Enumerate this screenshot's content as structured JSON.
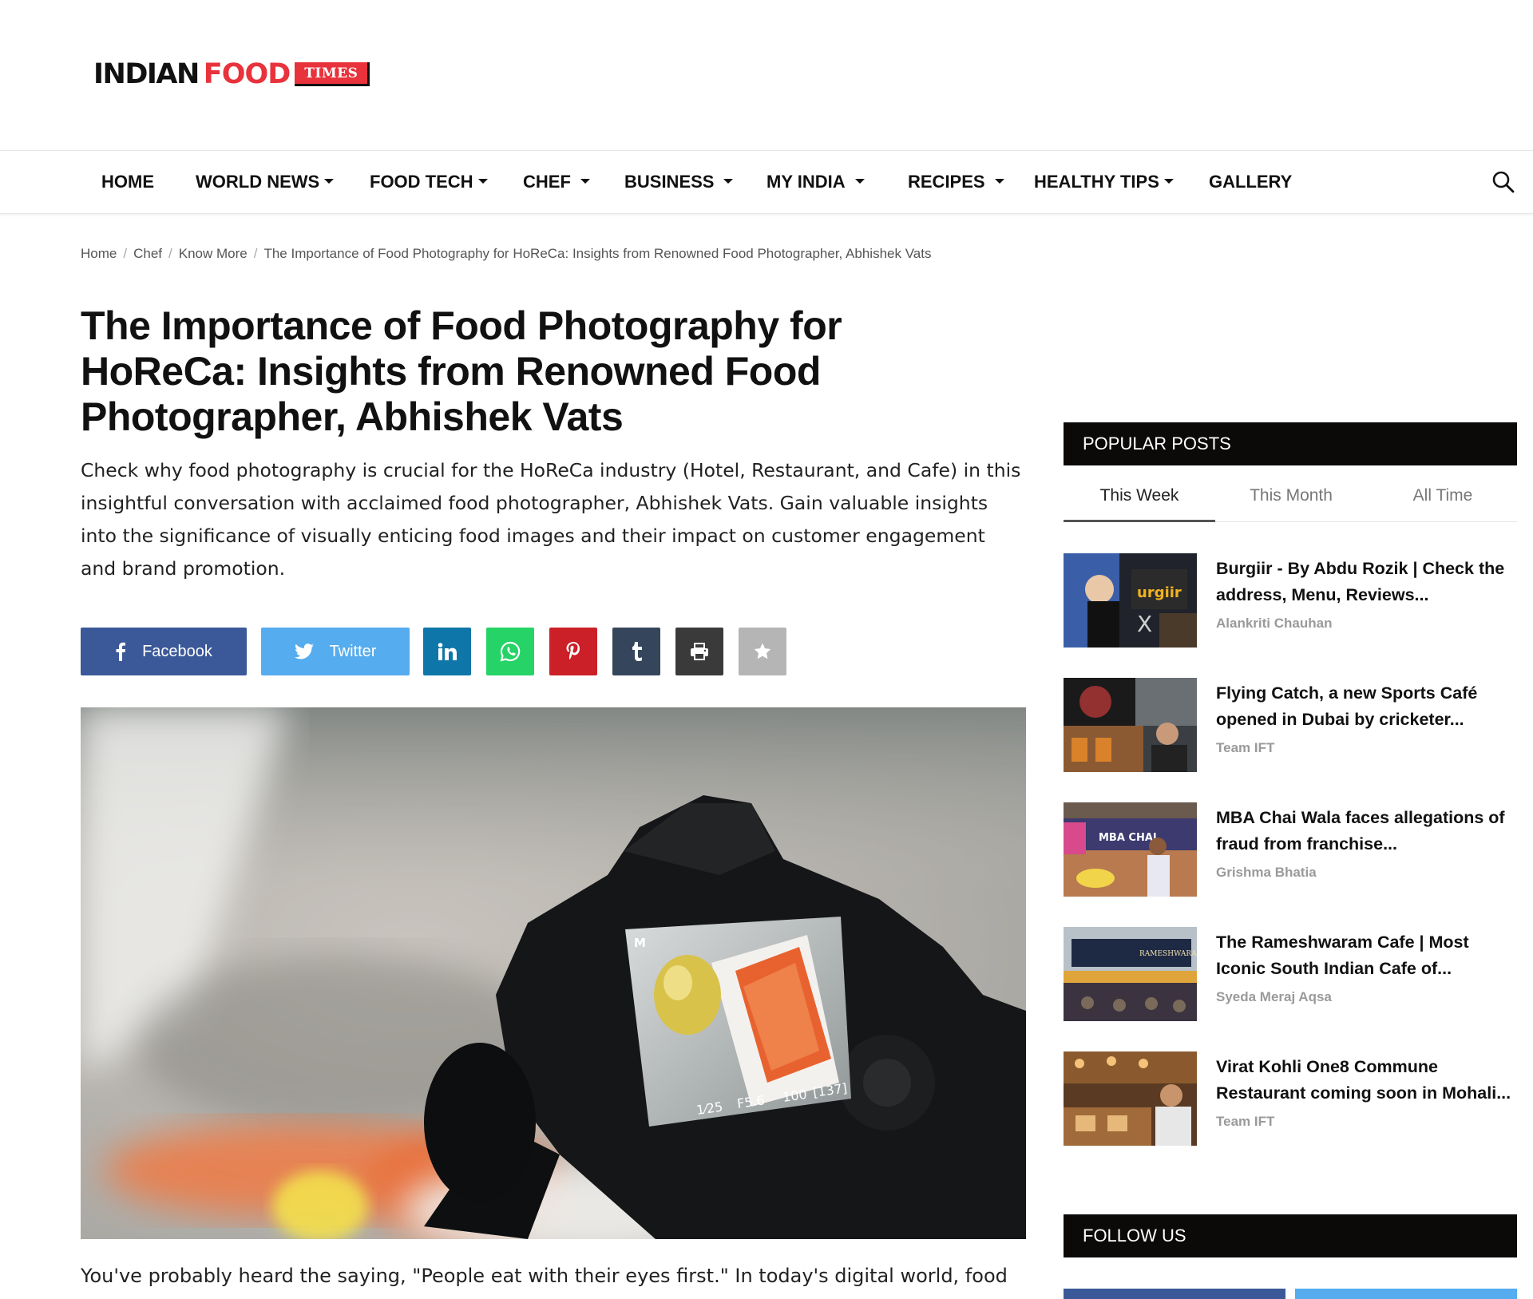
{
  "logo": {
    "part1": "INDIAN",
    "part2": "FOOD",
    "part3": "TIMES"
  },
  "nav": {
    "items": [
      {
        "label": "HOME",
        "dropdown": false
      },
      {
        "label": "WORLD NEWS",
        "dropdown": true
      },
      {
        "label": "FOOD TECH",
        "dropdown": true
      },
      {
        "label": "CHEF",
        "dropdown": true
      },
      {
        "label": "BUSINESS",
        "dropdown": true
      },
      {
        "label": "MY INDIA",
        "dropdown": true
      },
      {
        "label": "RECIPES",
        "dropdown": true
      },
      {
        "label": "HEALTHY TIPS",
        "dropdown": true
      },
      {
        "label": "GALLERY",
        "dropdown": false
      }
    ],
    "search_icon": "search-icon"
  },
  "breadcrumb": {
    "items": [
      "Home",
      "Chef",
      "Know More",
      "The Importance of Food Photography for HoReCa: Insights from Renowned Food Photographer, Abhishek Vats"
    ],
    "separator": "/"
  },
  "article": {
    "title": "The Importance of Food Photography for HoReCa: Insights from Renowned Food Photographer, Abhishek Vats",
    "summary": "Check why food photography is crucial for the HoReCa industry (Hotel, Restaurant, and Cafe) in this insightful conversation with acclaimed food photographer, Abhishek Vats. Gain valuable insights into the significance of visually enticing food images and their impact on customer engagement and brand promotion.",
    "body_first_line": "You've probably heard the saying, \"People eat with their eyes first.\" In today's digital world, food",
    "camera_display": {
      "mode": "M",
      "shutter": "1⁄25",
      "aperture": "F5.6",
      "iso": "100",
      "shots": "[137]"
    }
  },
  "share": {
    "facebook_label": "Facebook",
    "twitter_label": "Twitter",
    "colors": {
      "facebook": "#3b5998",
      "twitter": "#55acee",
      "linkedin": "#0e76a8",
      "whatsapp": "#25d366",
      "pinterest": "#cb2027",
      "tumblr": "#35465c",
      "print": "#3a3a3a",
      "bookmark": "#b5b5b5"
    }
  },
  "sidebar": {
    "popular_header": "POPULAR POSTS",
    "tabs": [
      "This Week",
      "This Month",
      "All Time"
    ],
    "active_tab": "This Week",
    "posts": [
      {
        "title": "Burgiir - By Abdu Rozik | Check the address, Menu, Reviews...",
        "author": "Alankriti Chauhan"
      },
      {
        "title": "Flying Catch, a new Sports Café opened in Dubai by cricketer...",
        "author": "Team IFT"
      },
      {
        "title": "MBA Chai Wala faces allegations of fraud from franchise...",
        "author": "Grishma Bhatia"
      },
      {
        "title": "The Rameshwaram Cafe | Most Iconic South Indian Cafe of...",
        "author": "Syeda Meraj Aqsa"
      },
      {
        "title": "Virat Kohli One8 Commune Restaurant coming soon in Mohali...",
        "author": "Team IFT"
      }
    ],
    "follow_header": "FOLLOW US"
  },
  "colors": {
    "brand_red": "#e8323c",
    "header_black": "#0c0909"
  }
}
